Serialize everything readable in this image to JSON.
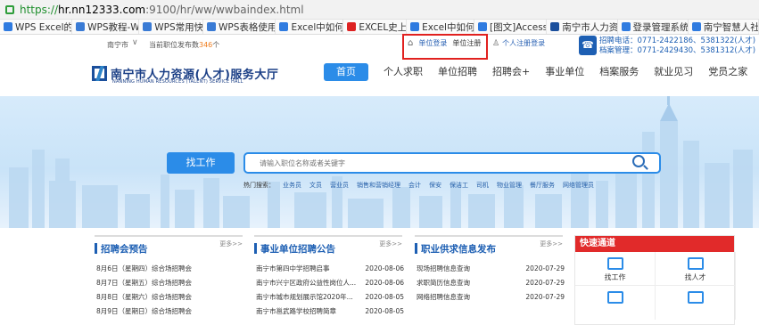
{
  "browser": {
    "url_scheme": "https://",
    "url_host": "hr.nn12333.com",
    "url_path": ":9100/hr/ww/wwbaindex.html",
    "bookmarks": [
      {
        "label": "WPS Excel的",
        "color": "#2f7be0"
      },
      {
        "label": "WPS教程-W",
        "color": "#3a7bd5"
      },
      {
        "label": "WPS常用快",
        "color": "#3a7bd5"
      },
      {
        "label": "WPS表格使用",
        "color": "#3a7bd5"
      },
      {
        "label": "Excel中如何",
        "color": "#2f7be0"
      },
      {
        "label": "EXCEL史上",
        "color": "#d22"
      },
      {
        "label": "Excel中如何",
        "color": "#2f7be0"
      },
      {
        "label": "[图文]Access",
        "color": "#2f7be0"
      },
      {
        "label": "南宁市人力资",
        "color": "#1b4f9c"
      },
      {
        "label": "登录管理系统",
        "color": "#2f7be0"
      },
      {
        "label": "南宁智慧人社",
        "color": "#2f7be0"
      }
    ]
  },
  "topbar": {
    "city": "南宁市",
    "jobs_prefix": "当前职位发布数",
    "jobs_count": "346",
    "jobs_suffix": "个",
    "unit_login": "单位登录",
    "unit_register": "单位注册",
    "personal_login": "个人注册登录",
    "phone_recruit": "招聘电话：0771-2422186、5381322(人才)",
    "phone_archive": "档案管理：0771-2429430、5381312(人才)"
  },
  "logo": {
    "title": "南宁市人力资源(人才)服务大厅",
    "subtitle": "NANNING HUMAN RESOURCES (TALENT) SERVICE HALL"
  },
  "nav": [
    "首页",
    "个人求职",
    "单位招聘",
    "招聘会+",
    "事业单位",
    "档案服务",
    "就业见习",
    "党员之家"
  ],
  "search": {
    "button": "找工作",
    "placeholder": "请输入职位名称或者关键字",
    "hot_label": "热门搜索：",
    "hot_keywords": [
      "业务员",
      "文员",
      "营业员",
      "销售和营销经理",
      "会计",
      "保安",
      "保洁工",
      "司机",
      "物业管理",
      "餐厅服务",
      "网络管理员"
    ]
  },
  "panels": [
    {
      "title": "招聘会预告",
      "more": "更多>>",
      "rows": [
        {
          "text": "8月6日（星期四）综合场招聘会",
          "date": ""
        },
        {
          "text": "8月7日（星期五）综合场招聘会",
          "date": ""
        },
        {
          "text": "8月8日（星期六）综合场招聘会",
          "date": ""
        },
        {
          "text": "8月9日（星期日）综合场招聘会",
          "date": ""
        }
      ]
    },
    {
      "title": "事业单位招聘公告",
      "more": "更多>>",
      "rows": [
        {
          "text": "南宁市第四中学招聘启事",
          "date": "2020-08-06"
        },
        {
          "text": "南宁市兴宁区政府公益性岗位人...",
          "date": "2020-08-06"
        },
        {
          "text": "南宁市城市规划展示馆2020年...",
          "date": "2020-08-05"
        },
        {
          "text": "南宁市邕武路学校招聘简章",
          "date": "2020-08-05"
        }
      ]
    },
    {
      "title": "职业供求信息发布",
      "more": "更多>>",
      "rows": [
        {
          "text": "现场招聘信息查询",
          "date": "2020-07-29"
        },
        {
          "text": "求职简历信息查询",
          "date": "2020-07-29"
        },
        {
          "text": "网络招聘信息查询",
          "date": "2020-07-29"
        },
        {
          "text": "",
          "date": ""
        }
      ]
    }
  ],
  "quick": {
    "title": "快速通道",
    "items": [
      "找工作",
      "找人才",
      "",
      ""
    ]
  }
}
